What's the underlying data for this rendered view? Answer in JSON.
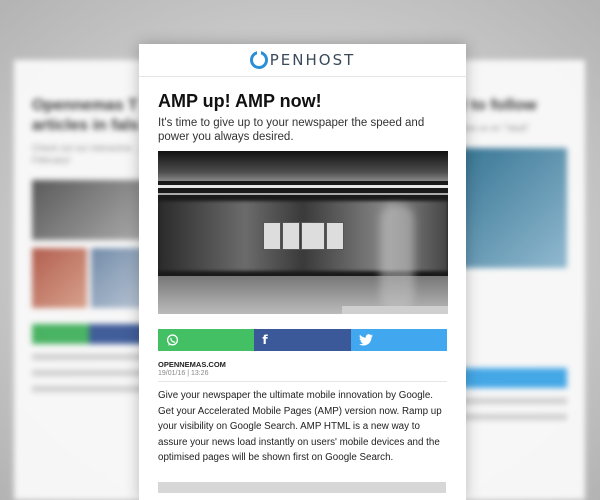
{
  "brand": {
    "logo_text": "PENHOST",
    "accent": "#2a8fd6"
  },
  "article": {
    "title": "AMP up! AMP now!",
    "subtitle": "It's time to give up to your newspaper the speed and power you always desired.",
    "source": "OPENNEMAS.COM",
    "date": "19/01/16 | 13:26",
    "body": "Give your newspaper the ultimate mobile innovation by Google. Get your Accelerated Mobile Pages (AMP) version now. Ramp up your visibility on Google Search. AMP HTML is a new way to assure your news load instantly on users' mobile devices and the optimised pages will be shown first on Google Search."
  },
  "share": {
    "whatsapp_icon": "whatsapp-icon",
    "facebook_icon": "facebook-icon",
    "twitter_icon": "twitter-icon",
    "facebook_glyph": "f",
    "colors": {
      "whatsapp": "#43c063",
      "facebook": "#3b5998",
      "twitter": "#41a8ef"
    }
  },
  "background_pages": {
    "left_title": "Opennemas T articles in fals",
    "left_sub": "Check out our interactive ... February!",
    "right_title": "al to follow",
    "right_sub": "follow us on \"Vault\""
  }
}
